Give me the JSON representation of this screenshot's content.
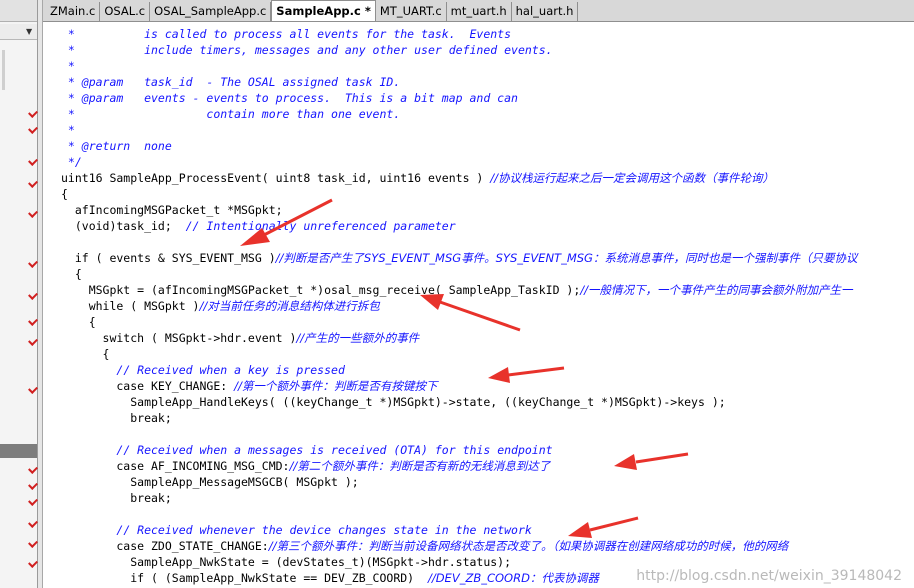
{
  "tabs": [
    {
      "label": "ZMain.c",
      "active": false
    },
    {
      "label": "OSAL.c",
      "active": false
    },
    {
      "label": "OSAL_SampleApp.c",
      "active": false
    },
    {
      "label": "SampleApp.c *",
      "active": true
    },
    {
      "label": "MT_UART.c",
      "active": false
    },
    {
      "label": "mt_uart.h",
      "active": false
    },
    {
      "label": "hal_uart.h",
      "active": false
    }
  ],
  "code_lines": [
    [
      {
        "t": " *          is called to process all events for the task.  Events",
        "c": "cmt"
      }
    ],
    [
      {
        "t": " *          include timers, messages and any other user defined events.",
        "c": "cmt"
      }
    ],
    [
      {
        "t": " *",
        "c": "cmt"
      }
    ],
    [
      {
        "t": " * @param   task_id  - The OSAL assigned task ID.",
        "c": "cmt"
      }
    ],
    [
      {
        "t": " * @param   events - events to process.  This is a bit map and can",
        "c": "cmt"
      }
    ],
    [
      {
        "t": " *                   contain more than one event.",
        "c": "cmt"
      }
    ],
    [
      {
        "t": " *",
        "c": "cmt"
      }
    ],
    [
      {
        "t": " * @return  none",
        "c": "cmt"
      }
    ],
    [
      {
        "t": " */",
        "c": "cmt"
      }
    ],
    [
      {
        "t": "uint16 SampleApp_ProcessEvent( uint8 task_id, uint16 events ) ",
        "c": ""
      },
      {
        "t": "//协议栈运行起来之后一定会调用这个函数（事件轮询）",
        "c": "cn"
      }
    ],
    [
      {
        "t": "{",
        "c": ""
      }
    ],
    [
      {
        "t": "  afIncomingMSGPacket_t *MSGpkt;",
        "c": ""
      }
    ],
    [
      {
        "t": "  (void)task_id;  ",
        "c": ""
      },
      {
        "t": "// Intentionally unreferenced parameter",
        "c": "cmt"
      }
    ],
    [
      {
        "t": "",
        "c": ""
      }
    ],
    [
      {
        "t": "  if ( events & SYS_EVENT_MSG )",
        "c": ""
      },
      {
        "t": "//判断是否产生了SYS_EVENT_MSG事件。SYS_EVENT_MSG：系统消息事件，同时也是一个强制事件（只要协议",
        "c": "cn"
      }
    ],
    [
      {
        "t": "  {",
        "c": ""
      }
    ],
    [
      {
        "t": "    MSGpkt = (afIncomingMSGPacket_t *)osal_msg_receive( SampleApp_TaskID );",
        "c": ""
      },
      {
        "t": "//一般情况下，一个事件产生的同事会额外附加产生一",
        "c": "cn"
      }
    ],
    [
      {
        "t": "    while ( MSGpkt )",
        "c": ""
      },
      {
        "t": "//对当前任务的消息结构体进行拆包",
        "c": "cn"
      }
    ],
    [
      {
        "t": "    {",
        "c": ""
      }
    ],
    [
      {
        "t": "      switch ( MSGpkt->hdr.event )",
        "c": ""
      },
      {
        "t": "//产生的一些额外的事件",
        "c": "cn"
      }
    ],
    [
      {
        "t": "      {",
        "c": ""
      }
    ],
    [
      {
        "t": "        ",
        "c": ""
      },
      {
        "t": "// Received when a key is pressed",
        "c": "cmt"
      }
    ],
    [
      {
        "t": "        case KEY_CHANGE: ",
        "c": ""
      },
      {
        "t": "//第一个额外事件：判断是否有按键按下",
        "c": "cn"
      }
    ],
    [
      {
        "t": "          SampleApp_HandleKeys( ((keyChange_t *)MSGpkt)->state, ((keyChange_t *)MSGpkt)->keys );",
        "c": ""
      }
    ],
    [
      {
        "t": "          break;",
        "c": ""
      }
    ],
    [
      {
        "t": "",
        "c": ""
      }
    ],
    [
      {
        "t": "        ",
        "c": ""
      },
      {
        "t": "// Received when a messages is received (OTA) for this endpoint",
        "c": "cmt"
      }
    ],
    [
      {
        "t": "        case AF_INCOMING_MSG_CMD:",
        "c": ""
      },
      {
        "t": "//第二个额外事件：判断是否有新的无线消息到达了",
        "c": "cn"
      }
    ],
    [
      {
        "t": "          SampleApp_MessageMSGCB( MSGpkt );",
        "c": ""
      }
    ],
    [
      {
        "t": "          break;",
        "c": ""
      }
    ],
    [
      {
        "t": "",
        "c": ""
      }
    ],
    [
      {
        "t": "        ",
        "c": ""
      },
      {
        "t": "// Received whenever the device changes state in the network",
        "c": "cmt"
      }
    ],
    [
      {
        "t": "        case ZDO_STATE_CHANGE:",
        "c": ""
      },
      {
        "t": "//第三个额外事件：判断当前设备网络状态是否改变了。（如果协调器在创建网络成功的时候，他的网络",
        "c": "cn"
      }
    ],
    [
      {
        "t": "          SampleApp_NwkState = (devStates_t)(MSGpkt->hdr.status);",
        "c": ""
      }
    ],
    [
      {
        "t": "          if ( (SampleApp_NwkState == DEV_ZB_COORD)  ",
        "c": ""
      },
      {
        "t": "//DEV_ZB_COORD：代表协调器",
        "c": "cn"
      }
    ]
  ],
  "watermark": "http://blog.csdn.net/weixin_39148042",
  "colors": {
    "comment": "#1515ff",
    "arrow": "#e8322b",
    "background": "#ffffff"
  }
}
